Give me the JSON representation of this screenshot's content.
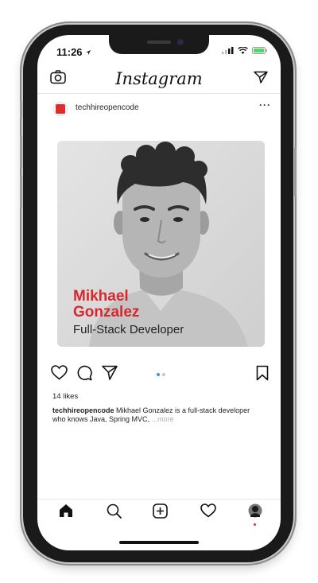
{
  "status_bar": {
    "time": "11:26"
  },
  "app": {
    "logo_text": "Instagram"
  },
  "post": {
    "username": "techhireopencode",
    "more_label": "···",
    "image": {
      "name_line1": "Mikhael",
      "name_line2": "Gonzalez",
      "role": "Full-Stack Developer"
    },
    "likes": "14 likes",
    "caption": {
      "user": "techhireopencode",
      "text": " Mikhael Gonzalez is a full-stack developer who knows Java, Spring MVC, ",
      "more": "...more"
    },
    "carousel": {
      "count": 2,
      "active": 1
    }
  },
  "icons": {
    "header_left": "camera-icon",
    "header_right": "direct-message-icon",
    "actions": [
      "heart-icon",
      "comment-icon",
      "share-icon",
      "bookmark-icon"
    ],
    "tabs": [
      "home-icon",
      "search-icon",
      "add-post-icon",
      "activity-heart-icon",
      "profile-avatar-icon"
    ]
  },
  "colors": {
    "name_red": "#d8282e",
    "carousel_active": "#3897f0",
    "carousel_inactive": "#c7c7c7"
  }
}
